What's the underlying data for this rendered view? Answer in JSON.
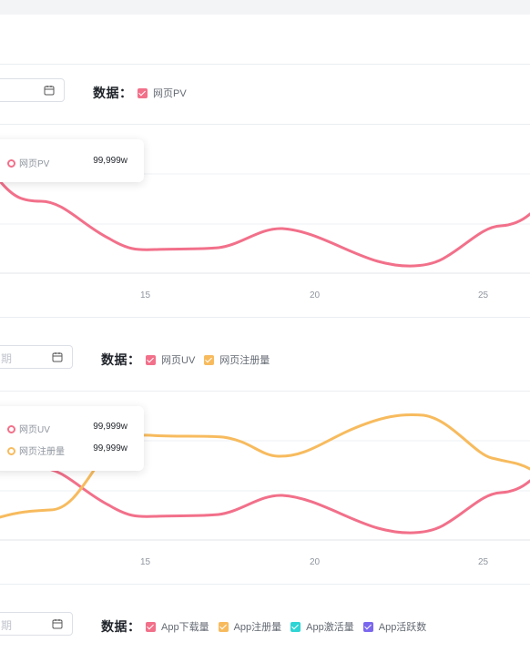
{
  "sections": [
    {
      "date_placeholder": "",
      "data_label": "数据：",
      "legend": [
        {
          "label": "网页PV",
          "color": "#f2708a"
        }
      ],
      "tooltip": [
        {
          "name": "网页PV",
          "value": "99,999w",
          "color": "#f2708a"
        }
      ],
      "x_ticks": [
        "15",
        "20",
        "25"
      ]
    },
    {
      "date_placeholder": "期",
      "data_label": "数据：",
      "legend": [
        {
          "label": "网页UV",
          "color": "#f2708a"
        },
        {
          "label": "网页注册量",
          "color": "#f7bb5e"
        }
      ],
      "tooltip": [
        {
          "name": "网页UV",
          "value": "99,999w",
          "color": "#f2708a"
        },
        {
          "name": "网页注册量",
          "value": "99,999w",
          "color": "#f7bb5e"
        }
      ],
      "x_ticks": [
        "15",
        "20",
        "25"
      ]
    },
    {
      "date_placeholder": "期",
      "data_label": "数据：",
      "legend": [
        {
          "label": "App下载量",
          "color": "#f2708a"
        },
        {
          "label": "App注册量",
          "color": "#f7bb5e"
        },
        {
          "label": "App激活量",
          "color": "#2fd4d4"
        },
        {
          "label": "App活跃数",
          "color": "#7b68ee"
        }
      ]
    }
  ]
}
